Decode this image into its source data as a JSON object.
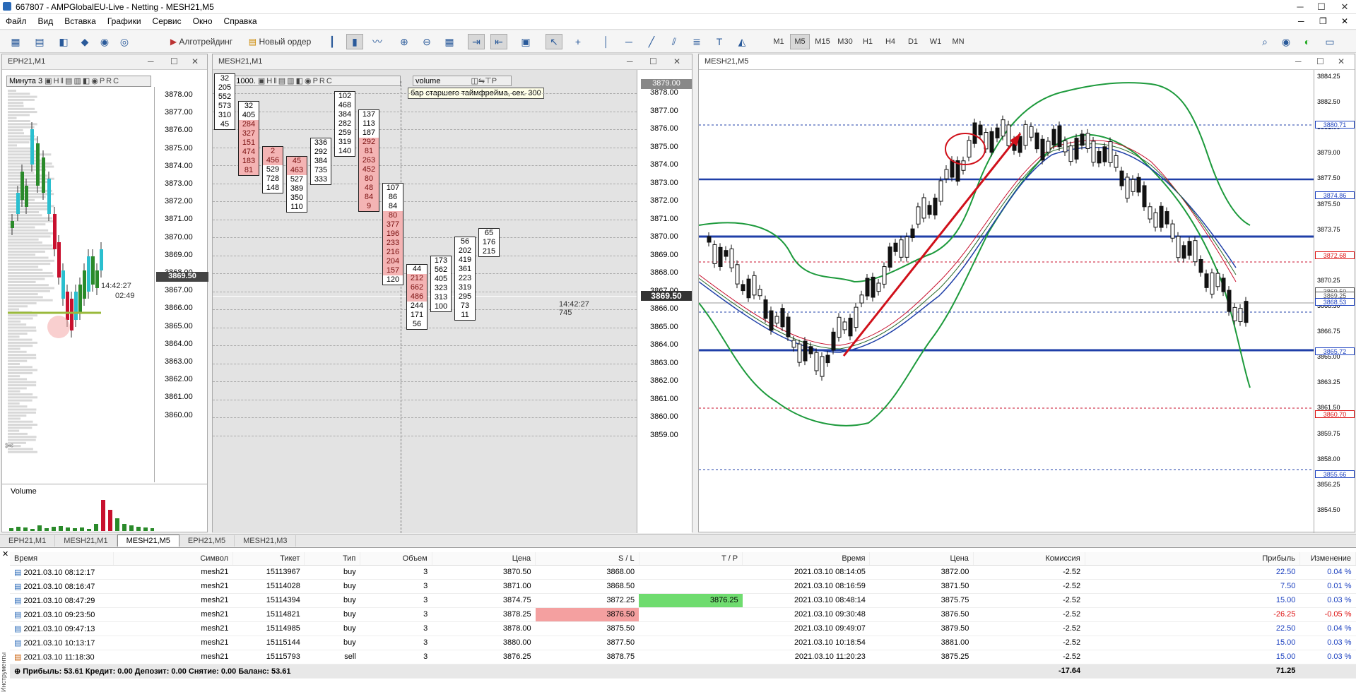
{
  "window": {
    "title": "667807 - AMPGlobalEU-Live - Netting - MESH21,M5"
  },
  "menu": [
    "Файл",
    "Вид",
    "Вставка",
    "Графики",
    "Сервис",
    "Окно",
    "Справка"
  ],
  "toolbar": {
    "algo_label": "Алготрейдинг",
    "new_order_label": "Новый ордер",
    "timeframes": [
      "M1",
      "M5",
      "M15",
      "M30",
      "H1",
      "H4",
      "D1",
      "W1",
      "MN"
    ],
    "active_tf": "M5"
  },
  "pane1": {
    "title": "EPH21,M1",
    "label_minute": "Минута",
    "minute_value": "3",
    "price_ticks": [
      "3878.00",
      "3877.00",
      "3876.00",
      "3875.00",
      "3874.00",
      "3873.00",
      "3872.00",
      "3871.00",
      "3870.00",
      "3869.00",
      "3868.00",
      "3867.00",
      "3866.00",
      "3865.00",
      "3864.00",
      "3863.00",
      "3862.00",
      "3861.00",
      "3860.00"
    ],
    "current_price": "3869.50",
    "time_label": "14:42:27",
    "countdown": "02:49",
    "volume_label": "Volume"
  },
  "pane2": {
    "title": "MESH21,M1",
    "ticks_label": "Тик. 1000.",
    "volume_btn": "volume",
    "tooltip": "бар старшего таймфрейма, сек. 300",
    "price_ticks": [
      "3878.00",
      "3877.00",
      "3876.00",
      "3875.00",
      "3874.00",
      "3873.00",
      "3872.00",
      "3871.00",
      "3870.00",
      "3869.00",
      "3868.00",
      "3867.00",
      "3866.00",
      "3865.00",
      "3864.00",
      "3863.00",
      "3862.00",
      "3861.00",
      "3860.00",
      "3859.00"
    ],
    "top_price": "3879.00",
    "current_price": "3869.50",
    "time_label": "14:42:27",
    "time_sub": "745",
    "clusters": [
      {
        "cells": [
          "32",
          "205",
          "552",
          "573",
          "310",
          "45"
        ],
        "reds": []
      },
      {
        "cells": [
          "32",
          "405",
          "284",
          "327",
          "151",
          "474",
          "183",
          "81"
        ],
        "reds": [
          2,
          3,
          4,
          5,
          6,
          7
        ]
      },
      {
        "cells": [
          "2",
          "456",
          "529",
          "728",
          "148"
        ],
        "reds": [
          0,
          1
        ]
      },
      {
        "cells": [
          "45",
          "463",
          "527",
          "389",
          "350",
          "110"
        ],
        "reds": [
          0,
          1
        ]
      },
      {
        "cells": [
          "336",
          "292",
          "384",
          "735",
          "333"
        ],
        "reds": []
      },
      {
        "cells": [
          "102",
          "468",
          "384",
          "282",
          "259",
          "319",
          "140"
        ],
        "reds": []
      },
      {
        "cells": [
          "137",
          "113",
          "187",
          "292",
          "81",
          "263",
          "452",
          "80",
          "48",
          "84",
          "9"
        ],
        "reds": [
          3,
          4,
          5,
          6,
          7,
          8,
          9,
          10
        ]
      },
      {
        "cells": [
          "107",
          "86",
          "84",
          "80",
          "377",
          "196",
          "233",
          "216",
          "204",
          "157",
          "120"
        ],
        "reds": [
          3,
          4,
          5,
          6,
          7,
          8,
          9
        ]
      },
      {
        "cells": [
          "44",
          "212",
          "662",
          "486",
          "244",
          "171",
          "56"
        ],
        "reds": [
          1,
          2,
          3
        ]
      },
      {
        "cells": [
          "173",
          "562",
          "405",
          "323",
          "313",
          "100"
        ],
        "reds": []
      },
      {
        "cells": [
          "56",
          "202",
          "419",
          "361",
          "223",
          "319",
          "295",
          "73",
          "11"
        ],
        "reds": []
      },
      {
        "cells": [
          "65",
          "176",
          "215"
        ],
        "reds": []
      }
    ]
  },
  "pane3": {
    "title": "MESH21,M5",
    "price_ticks": [
      "3884.25",
      "3882.50",
      "3881.00",
      "3879.00",
      "3877.50",
      "3875.50",
      "3873.75",
      "3872.00",
      "3870.25",
      "3868.50",
      "3866.75",
      "3865.00",
      "3863.25",
      "3861.50",
      "3859.75",
      "3858.00",
      "3856.25",
      "3854.50"
    ],
    "markers": [
      {
        "v": "3880.71",
        "color": "#1a3fbf"
      },
      {
        "v": "3874.86",
        "color": "#1a3fbf"
      },
      {
        "v": "3872.68",
        "color": "#d11"
      },
      {
        "v": "3869.50",
        "color": "#555"
      },
      {
        "v": "3869.25",
        "color": "#555"
      },
      {
        "v": "3868.53",
        "color": "#1a3fbf"
      },
      {
        "v": "3865.72",
        "color": "#1a3fbf"
      },
      {
        "v": "3860.70",
        "color": "#d11"
      },
      {
        "v": "3855.66",
        "color": "#1a3fbf"
      }
    ]
  },
  "tabs": [
    "EPH21,M1",
    "MESH21,M1",
    "MESH21,M5",
    "EPH21,M5",
    "MESH21,M3"
  ],
  "active_tab": "MESH21,M5",
  "trades": {
    "columns": [
      "Время",
      "Символ",
      "Тикет",
      "Тип",
      "Объем",
      "Цена",
      "S / L",
      "T / P",
      "Время",
      "Цена",
      "Комиссия",
      "Прибыль",
      "Изменение"
    ],
    "rows": [
      [
        "2021.03.10 08:12:17",
        "mesh21",
        "15113967",
        "buy",
        "3",
        "3870.50",
        "3868.00",
        "",
        "2021.03.10 08:14:05",
        "3872.00",
        "-2.52",
        "22.50",
        "0.04 %"
      ],
      [
        "2021.03.10 08:16:47",
        "mesh21",
        "15114028",
        "buy",
        "3",
        "3871.00",
        "3868.50",
        "",
        "2021.03.10 08:16:59",
        "3871.50",
        "-2.52",
        "7.50",
        "0.01 %"
      ],
      [
        "2021.03.10 08:47:29",
        "mesh21",
        "15114394",
        "buy",
        "3",
        "3874.75",
        "3872.25",
        "3876.25",
        "2021.03.10 08:48:14",
        "3875.75",
        "-2.52",
        "15.00",
        "0.03 %"
      ],
      [
        "2021.03.10 09:23:50",
        "mesh21",
        "15114821",
        "buy",
        "3",
        "3878.25",
        "3876.50",
        "",
        "2021.03.10 09:30:48",
        "3876.50",
        "-2.52",
        "-26.25",
        "-0.05 %"
      ],
      [
        "2021.03.10 09:47:13",
        "mesh21",
        "15114985",
        "buy",
        "3",
        "3878.00",
        "3875.50",
        "",
        "2021.03.10 09:49:07",
        "3879.50",
        "-2.52",
        "22.50",
        "0.04 %"
      ],
      [
        "2021.03.10 10:13:17",
        "mesh21",
        "15115144",
        "buy",
        "3",
        "3880.00",
        "3877.50",
        "",
        "2021.03.10 10:18:54",
        "3881.00",
        "-2.52",
        "15.00",
        "0.03 %"
      ],
      [
        "2021.03.10 11:18:30",
        "mesh21",
        "15115793",
        "sell",
        "3",
        "3876.25",
        "3878.75",
        "",
        "2021.03.10 11:20:23",
        "3875.25",
        "-2.52",
        "15.00",
        "0.03 %"
      ]
    ],
    "summary": "Прибыль: 53.61  Кредит: 0.00  Депозит: 0.00  Снятие: 0.00  Баланс: 53.61",
    "total_commission": "-17.64",
    "total_profit": "71.25",
    "side_label": "Инструменты"
  }
}
